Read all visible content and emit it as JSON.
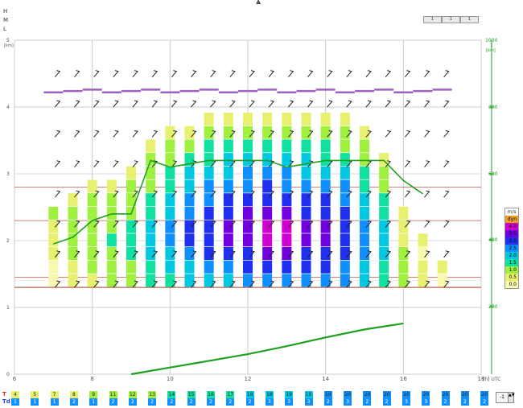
{
  "levels": {
    "h": "H",
    "m": "M",
    "l": "L"
  },
  "top_buttons": [
    "1",
    "1",
    "1"
  ],
  "collapse_icon": "caret-up-icon",
  "chart_data": {
    "type": "bar",
    "x": [
      7,
      7.5,
      8,
      8.5,
      9,
      9.5,
      10,
      10.5,
      11,
      11.5,
      12,
      12.5,
      13,
      13.5,
      14,
      14.5,
      15,
      15.5,
      16,
      16.5,
      17
    ],
    "x_axis": {
      "ticks": [
        "6",
        "8",
        "10",
        "12",
        "14",
        "16",
        "18"
      ],
      "unit": "[h] UTC",
      "range": [
        6,
        18
      ]
    },
    "left_axis": {
      "unit": "[km]",
      "ticks": [
        "0",
        "1",
        "2",
        "3",
        "4",
        "5"
      ],
      "range": [
        0,
        5
      ]
    },
    "right_axis": {
      "unit": "[km]",
      "top": "1000",
      "ticks": [
        "200",
        "400",
        "600",
        "800",
        "1000"
      ],
      "label_top": "1"
    },
    "wind_legend": {
      "title": "m/s",
      "entries": [
        "dyn",
        "4.0",
        "3.5",
        "3.0",
        "2.5",
        "2.0",
        "1.5",
        "1.0",
        "0.5",
        "0.0"
      ],
      "colors": [
        "#f0a020",
        "#d000d0",
        "#7000e0",
        "#2030f0",
        "#1090ff",
        "#00c8e0",
        "#10e0a0",
        "#a0f040",
        "#e8f070",
        "#f8f8b0"
      ]
    },
    "boundary_layer_top_km": [
      1.95,
      2.05,
      2.3,
      2.4,
      2.4,
      3.2,
      3.1,
      3.15,
      3.2,
      3.2,
      3.2,
      3.2,
      3.1,
      3.15,
      3.2,
      3.2,
      3.2,
      3.2,
      2.9,
      2.7
    ],
    "cloud_base_line": [
      0.0,
      0.15,
      0.3,
      0.42,
      0.56,
      0.68,
      0.76
    ],
    "temperature": {
      "label": "T",
      "values": [
        "4",
        "5",
        "7",
        "8",
        "9",
        "11",
        "12",
        "13",
        "14",
        "15",
        "16",
        "17",
        "18",
        "18",
        "19",
        "19",
        "19",
        "20",
        "20",
        "20",
        "20",
        "20",
        "20",
        "20",
        "20"
      ]
    },
    "dewpoint": {
      "label": "Td",
      "values": [
        "1",
        "1",
        "1",
        "2",
        "1",
        "2",
        "2",
        "2",
        "2",
        "2",
        "2",
        "2",
        "2",
        "3",
        "3",
        "3",
        "2",
        "3",
        "2",
        "2",
        "3",
        "3",
        "2",
        "2",
        "2"
      ]
    }
  },
  "spinner": {
    "value": "-1",
    "arrow": "▲▼"
  }
}
